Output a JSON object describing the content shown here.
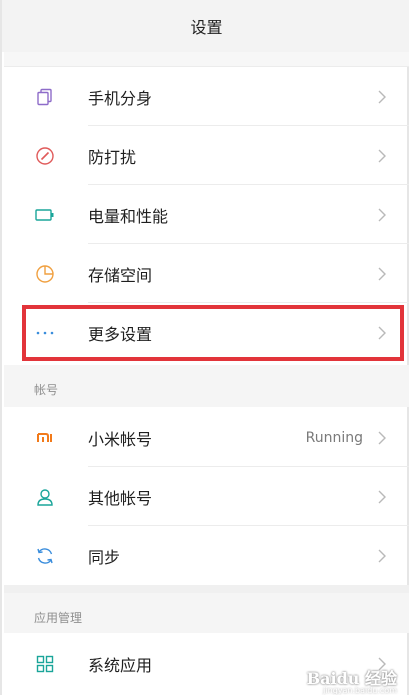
{
  "header": {
    "title": "设置"
  },
  "rows": [
    {
      "label": "手机分身",
      "icon": "copy-icon"
    },
    {
      "label": "防打扰",
      "icon": "compass-icon"
    },
    {
      "label": "电量和性能",
      "icon": "battery-icon"
    },
    {
      "label": "存储空间",
      "icon": "pie-chart-icon"
    },
    {
      "label": "更多设置",
      "icon": "more-dots-icon"
    }
  ],
  "accounts": {
    "title": "帐号",
    "rows": [
      {
        "label": "小米帐号",
        "value": "Running",
        "icon": "mi-logo-icon"
      },
      {
        "label": "其他帐号",
        "icon": "user-icon"
      },
      {
        "label": "同步",
        "icon": "sync-icon"
      }
    ]
  },
  "apps": {
    "title": "应用管理",
    "rows": [
      {
        "label": "系统应用",
        "icon": "grid-icon"
      }
    ]
  },
  "watermark": {
    "text": "Baidu 经验",
    "sub": "jingyan.baidu.com"
  },
  "colors": {
    "purple": "#8e6cc9",
    "red": "#e05a5a",
    "teal": "#1aa59a",
    "orange": "#f0a040",
    "blue": "#3a8ddc",
    "mi_orange": "#f27a1a",
    "highlight": "#e2343a"
  }
}
